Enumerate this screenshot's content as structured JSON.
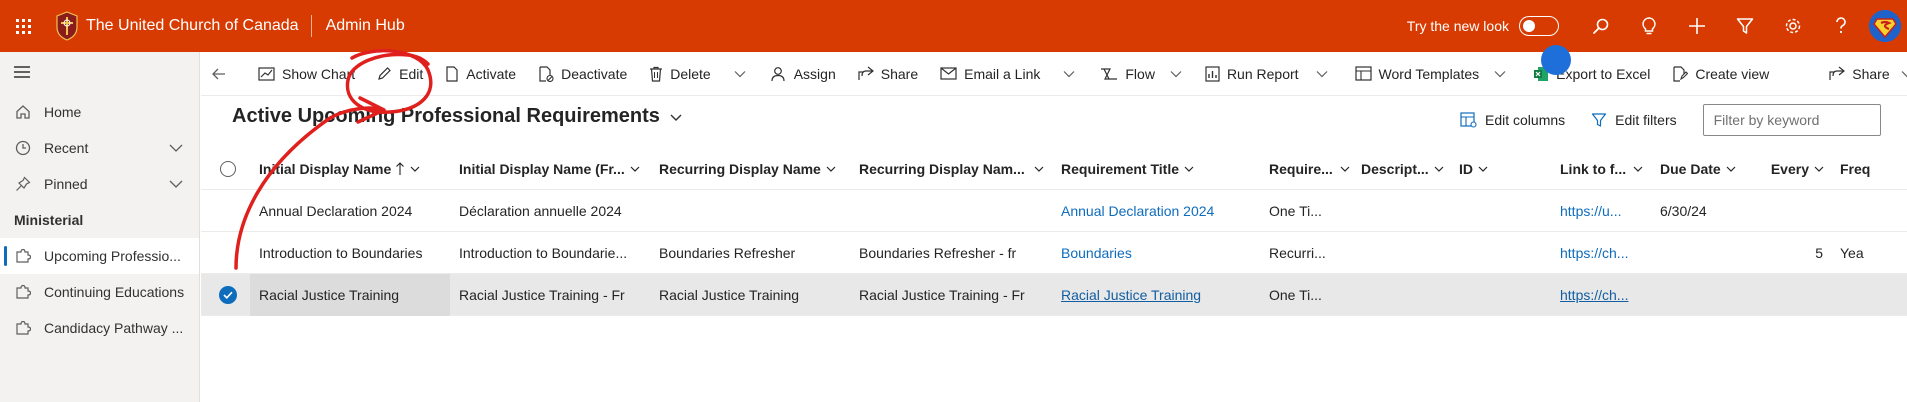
{
  "header": {
    "org_name": "The United Church of Canada",
    "app_name": "Admin Hub",
    "try_new_look": "Try the new look",
    "icons": [
      "search-icon",
      "lightbulb-icon",
      "plus-icon",
      "filter-icon",
      "settings-icon",
      "help-icon"
    ],
    "brand_color": "#d83b01"
  },
  "sidebar": {
    "items": [
      {
        "label": "Home",
        "icon": "home-icon"
      },
      {
        "label": "Recent",
        "icon": "clock-icon"
      },
      {
        "label": "Pinned",
        "icon": "pin-icon"
      }
    ],
    "section": "Ministerial",
    "section_items": [
      {
        "label": "Upcoming Professio...",
        "icon": "puzzle-icon"
      },
      {
        "label": "Continuing Educations",
        "icon": "puzzle-icon"
      },
      {
        "label": "Candidacy Pathway ...",
        "icon": "puzzle-icon"
      }
    ]
  },
  "commands": {
    "show_chart": "Show Chart",
    "edit": "Edit",
    "activate": "Activate",
    "deactivate": "Deactivate",
    "delete": "Delete",
    "assign": "Assign",
    "share": "Share",
    "email_link": "Email a Link",
    "flow": "Flow",
    "run_report": "Run Report",
    "word_templates": "Word Templates",
    "export_excel": "Export to Excel",
    "create_view": "Create view",
    "share_right": "Share"
  },
  "view": {
    "title": "Active Upcoming Professional Requirements",
    "edit_columns": "Edit columns",
    "edit_filters": "Edit filters",
    "filter_placeholder": "Filter by keyword"
  },
  "grid": {
    "columns": [
      "Initial Display Name",
      "Initial Display Name (Fr...",
      "Recurring Display Name",
      "Recurring Display Nam...",
      "Requirement Title",
      "Require...",
      "Descript...",
      "ID",
      "Link to f...",
      "Due Date",
      "Every",
      "Freq"
    ],
    "rows": [
      {
        "initial": "Annual Declaration 2024",
        "initial_fr": "Déclaration annuelle 2024",
        "recurring": "",
        "recurring_fr": "",
        "title": "Annual Declaration 2024",
        "req": "One Ti...",
        "desc": "",
        "id": "",
        "link": "https://u...",
        "due": "6/30/24",
        "every": "",
        "freq": "",
        "selected": false
      },
      {
        "initial": "Introduction to Boundaries",
        "initial_fr": "Introduction to Boundarie...",
        "recurring": "Boundaries Refresher",
        "recurring_fr": "Boundaries Refresher - fr",
        "title": "Boundaries",
        "req": "Recurri...",
        "desc": "",
        "id": "",
        "link": "https://ch...",
        "due": "",
        "every": "5",
        "freq": "Yea",
        "selected": false
      },
      {
        "initial": "Racial Justice Training",
        "initial_fr": "Racial Justice Training - Fr",
        "recurring": "Racial Justice Training",
        "recurring_fr": "Racial Justice Training - Fr",
        "title": "Racial Justice Training",
        "req": "One Ti...",
        "desc": "",
        "id": "",
        "link": "https://ch...",
        "due": "",
        "every": "",
        "freq": "",
        "selected": true
      }
    ]
  }
}
